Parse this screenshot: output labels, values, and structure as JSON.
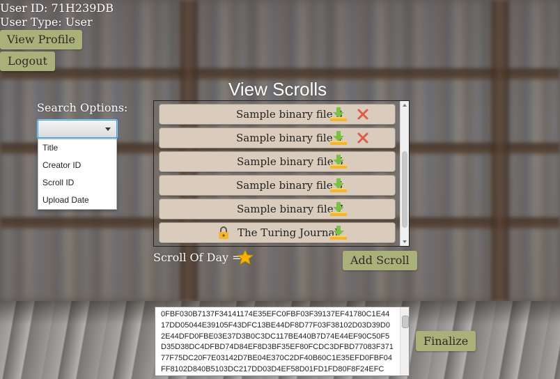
{
  "user": {
    "id_text": "User ID: 71H239DB",
    "type_text": "User Type: User",
    "view_profile_label": "View Profile",
    "logout_label": "Logout"
  },
  "page_title": "View Scrolls",
  "search": {
    "label": "Search Options:",
    "selected_value": "",
    "options": [
      "Title",
      "Creator ID",
      "Scroll ID",
      "Upload Date"
    ]
  },
  "scrolls": [
    {
      "name": "Sample binary file 3",
      "locked": false,
      "deletable": true
    },
    {
      "name": "Sample binary file 4",
      "locked": false,
      "deletable": true
    },
    {
      "name": "Sample binary file 5",
      "locked": false,
      "deletable": false
    },
    {
      "name": "Sample binary file 6",
      "locked": false,
      "deletable": false
    },
    {
      "name": "Sample binary file 7",
      "locked": false,
      "deletable": false
    },
    {
      "name": "The Turing Journal",
      "locked": true,
      "deletable": false
    }
  ],
  "scroll_of_day_label": "Scroll Of Day =",
  "add_scroll_label": "Add Scroll",
  "finalize_label": "Finalize",
  "hex_content": "0FBF030B7137F34141174E35EFC0FBF03F39137EF41780C1E4417DD05044E39105F43DFC13BE44DF8D77F03F38102D03D39D02E44DFD0FBE03E37D3B0C3DC117BE440B7D74E44EF90C50F5D35D38DC4DFBD74D84EF8D3BF35EF80FCDC3DFBD77083F37177F75DC20F7E03142D7BE04E370C2DF40B60C1E35EFD0FBF04FF8102D840B5103DC217DD03D4EF58D01FD1FD80F8F24EFC",
  "colors": {
    "button_green": "#a9b07a",
    "row_bg": "#d9ccbc",
    "delete_red": "#e05a4a",
    "download_green": "#7bc043",
    "tray_yellow": "#f2b632",
    "star_gold": "#f5b400"
  },
  "icons": {
    "download": "download-icon",
    "delete": "delete-x-icon",
    "lock": "lock-icon",
    "star": "star-icon"
  }
}
